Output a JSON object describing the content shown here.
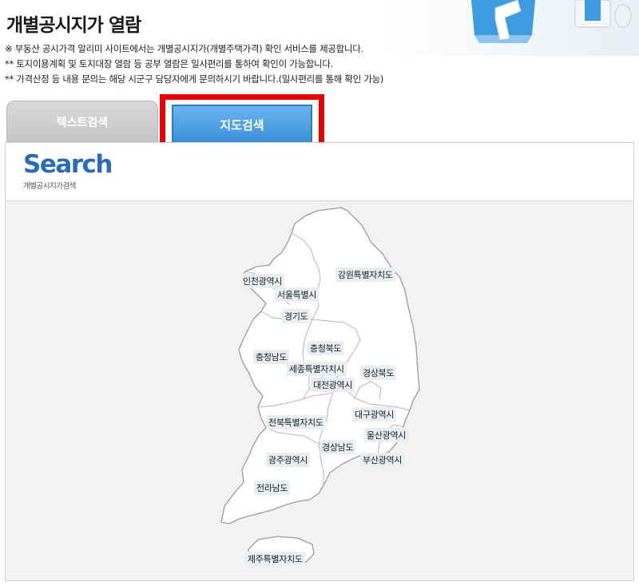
{
  "page": {
    "title": "개별공시지가 열람",
    "notices": [
      "※ 부동산 공시가격 알리미 사이트에서는 개별공시지가(개별주택가격) 확인 서비스를 제공합니다.",
      "** 토지이용계획 및 토지대장 열람 등 공부 열람은 일사편리를 통하여 확인이 가능합니다.",
      "** 가격산정 등 내용 문의는 해당 시군구 담당자에게 문의하시기 바랍니다.(일사편리를 통해 확인 가능)"
    ]
  },
  "tabs": {
    "text_search": "텍스트검색",
    "map_search": "지도검색"
  },
  "search_logo": {
    "word": "Search",
    "subtitle": "개별공시지가검색"
  },
  "regions": {
    "incheon": "인천광역시",
    "gangwon": "강원특별자치도",
    "seoul": "서울특별시",
    "gyeonggi": "경기도",
    "chungbuk": "충청북도",
    "chungnam": "충청남도",
    "sejong": "세종특별자치시",
    "gyeongbuk": "경상북도",
    "daejeon": "대전광역시",
    "daegu": "대구광역시",
    "jeonbuk": "전북특별자치도",
    "ulsan": "울산광역시",
    "gyeongnam": "경상남도",
    "gwangju": "광주광역시",
    "busan": "부산광역시",
    "jeonnam": "전라남도",
    "jeju": "제주특별자치도"
  },
  "colors": {
    "highlight_border": "#e60000",
    "active_tab": "#3a8fd8",
    "search_logo": "#2b6cb8"
  }
}
